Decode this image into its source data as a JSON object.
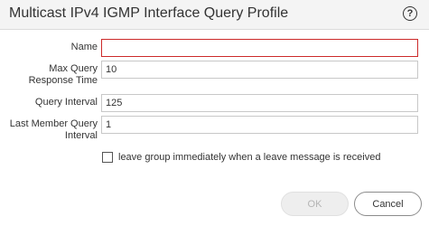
{
  "dialog": {
    "title": "Multicast IPv4 IGMP Interface Query Profile",
    "help_icon": "?"
  },
  "form": {
    "name": {
      "label": "Name",
      "value": ""
    },
    "max_query_response_time": {
      "label_line1": "Max Query",
      "label_line2": "Response Time",
      "value": "10"
    },
    "query_interval": {
      "label": "Query Interval",
      "value": "125"
    },
    "last_member_query_interval": {
      "label_line1": "Last Member Query",
      "label_line2": "Interval",
      "value": "1"
    },
    "leave_group": {
      "label": "leave group immediately when a leave message is received",
      "checked": false
    }
  },
  "buttons": {
    "ok": "OK",
    "cancel": "Cancel"
  },
  "colors": {
    "header_bg": "#f4f4f4",
    "required_border": "#cc2a2a",
    "disabled_text": "#b4b4b4"
  }
}
